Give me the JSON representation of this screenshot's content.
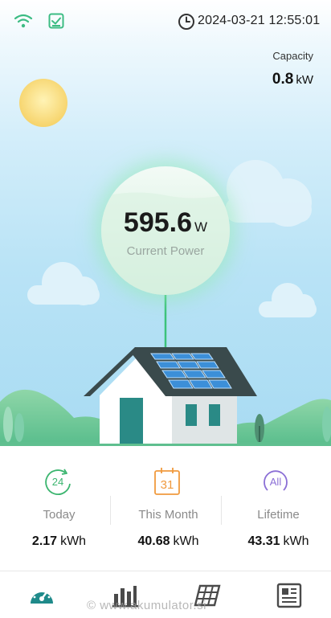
{
  "status_bar": {
    "datetime": "2024-03-21 12:55:01"
  },
  "capacity": {
    "label": "Capacity",
    "value": "0.8",
    "unit": "kW"
  },
  "current_power": {
    "value": "595.6",
    "unit": "W",
    "label": "Current Power"
  },
  "stats": [
    {
      "icon_text": "24",
      "label": "Today",
      "value": "2.17",
      "unit": "kWh",
      "color": "#3bb56f"
    },
    {
      "icon_text": "31",
      "label": "This Month",
      "value": "40.68",
      "unit": "kWh",
      "color": "#f09a3e"
    },
    {
      "icon_text": "All",
      "label": "Lifetime",
      "value": "43.31",
      "unit": "kWh",
      "color": "#8b6fd6"
    }
  ],
  "tabs": [
    "dashboard-icon",
    "chart-bars-icon",
    "solar-panel-icon",
    "report-icon"
  ],
  "watermark": "© www.akumulator.si",
  "colors": {
    "accent": "#1f8a8a",
    "green": "#3bb56f",
    "orange": "#f09a3e",
    "purple": "#8b6fd6"
  }
}
